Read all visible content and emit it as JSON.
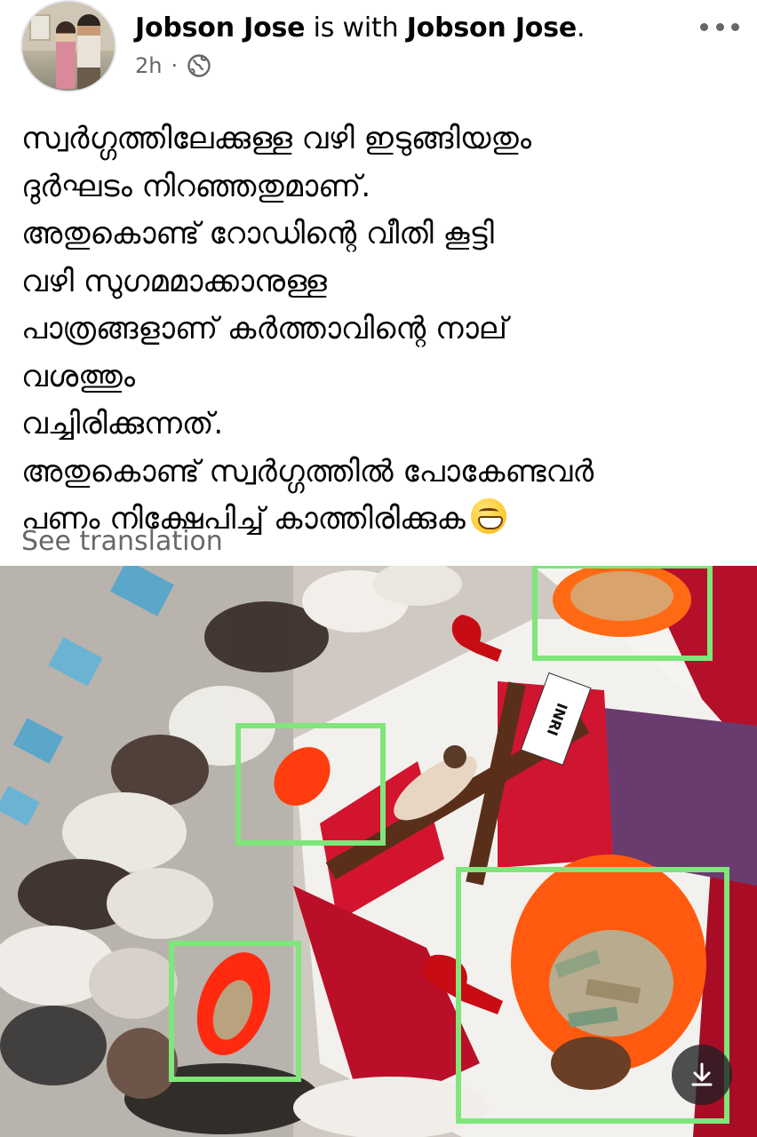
{
  "post": {
    "author": "Jobson Jose",
    "connector": " is with ",
    "tagged": "Jobson Jose",
    "period": ".",
    "time": "2h",
    "separator": "·",
    "audience_icon": "globe-icon",
    "more_icon": "more-horizontal-icon",
    "text_lines": [
      "സ്വർഗ്ഗത്തിലേക്കുള്ള വഴി ഇടുങ്ങിയതും",
      "ദുർഘടം നിറഞ്ഞതുമാണ്.",
      "അതുകൊണ്ട് റോഡിന്റെ വീതി കൂട്ടി",
      "വഴി സുഗമമാക്കാനുള്ള",
      "പാത്രങ്ങളാണ് കർത്താവിന്റെ നാല്",
      "വശത്തും",
      "വച്ചിരിക്കുന്നത്.",
      "അതുകൊണ്ട് സ്വർഗ്ഗത്തിൽ പോകേണ്ടവർ",
      "പണം നിക്ഷേപിച്ച് കാത്തിരിക്കുക"
    ],
    "emoji": "grinning-face-emoji",
    "see_translation": "See translation",
    "photo_sign": "INRI",
    "download_icon": "download-icon"
  },
  "colors": {
    "name_text": "#050505",
    "meta_text": "#65676b",
    "highlight_box": "#7ee67a",
    "bowl_orange": "#ff5a0f",
    "altar_red": "#c0102a"
  }
}
